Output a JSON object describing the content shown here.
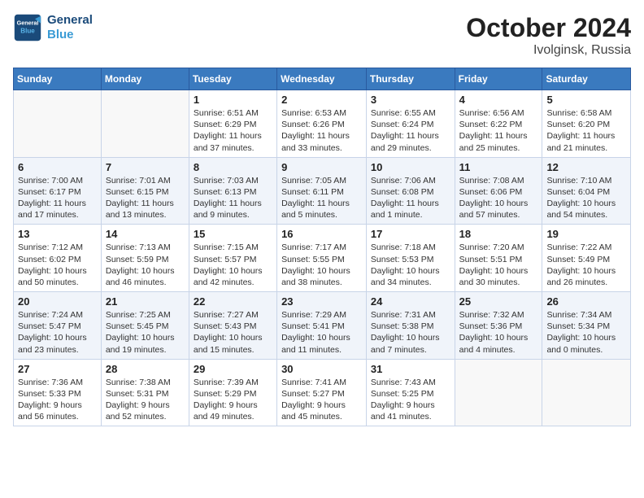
{
  "header": {
    "logo_line1": "General",
    "logo_line2": "Blue",
    "month": "October 2024",
    "location": "Ivolginsk, Russia"
  },
  "weekdays": [
    "Sunday",
    "Monday",
    "Tuesday",
    "Wednesday",
    "Thursday",
    "Friday",
    "Saturday"
  ],
  "weeks": [
    [
      {
        "day": "",
        "info": ""
      },
      {
        "day": "",
        "info": ""
      },
      {
        "day": "1",
        "info": "Sunrise: 6:51 AM\nSunset: 6:29 PM\nDaylight: 11 hours and 37 minutes."
      },
      {
        "day": "2",
        "info": "Sunrise: 6:53 AM\nSunset: 6:26 PM\nDaylight: 11 hours and 33 minutes."
      },
      {
        "day": "3",
        "info": "Sunrise: 6:55 AM\nSunset: 6:24 PM\nDaylight: 11 hours and 29 minutes."
      },
      {
        "day": "4",
        "info": "Sunrise: 6:56 AM\nSunset: 6:22 PM\nDaylight: 11 hours and 25 minutes."
      },
      {
        "day": "5",
        "info": "Sunrise: 6:58 AM\nSunset: 6:20 PM\nDaylight: 11 hours and 21 minutes."
      }
    ],
    [
      {
        "day": "6",
        "info": "Sunrise: 7:00 AM\nSunset: 6:17 PM\nDaylight: 11 hours and 17 minutes."
      },
      {
        "day": "7",
        "info": "Sunrise: 7:01 AM\nSunset: 6:15 PM\nDaylight: 11 hours and 13 minutes."
      },
      {
        "day": "8",
        "info": "Sunrise: 7:03 AM\nSunset: 6:13 PM\nDaylight: 11 hours and 9 minutes."
      },
      {
        "day": "9",
        "info": "Sunrise: 7:05 AM\nSunset: 6:11 PM\nDaylight: 11 hours and 5 minutes."
      },
      {
        "day": "10",
        "info": "Sunrise: 7:06 AM\nSunset: 6:08 PM\nDaylight: 11 hours and 1 minute."
      },
      {
        "day": "11",
        "info": "Sunrise: 7:08 AM\nSunset: 6:06 PM\nDaylight: 10 hours and 57 minutes."
      },
      {
        "day": "12",
        "info": "Sunrise: 7:10 AM\nSunset: 6:04 PM\nDaylight: 10 hours and 54 minutes."
      }
    ],
    [
      {
        "day": "13",
        "info": "Sunrise: 7:12 AM\nSunset: 6:02 PM\nDaylight: 10 hours and 50 minutes."
      },
      {
        "day": "14",
        "info": "Sunrise: 7:13 AM\nSunset: 5:59 PM\nDaylight: 10 hours and 46 minutes."
      },
      {
        "day": "15",
        "info": "Sunrise: 7:15 AM\nSunset: 5:57 PM\nDaylight: 10 hours and 42 minutes."
      },
      {
        "day": "16",
        "info": "Sunrise: 7:17 AM\nSunset: 5:55 PM\nDaylight: 10 hours and 38 minutes."
      },
      {
        "day": "17",
        "info": "Sunrise: 7:18 AM\nSunset: 5:53 PM\nDaylight: 10 hours and 34 minutes."
      },
      {
        "day": "18",
        "info": "Sunrise: 7:20 AM\nSunset: 5:51 PM\nDaylight: 10 hours and 30 minutes."
      },
      {
        "day": "19",
        "info": "Sunrise: 7:22 AM\nSunset: 5:49 PM\nDaylight: 10 hours and 26 minutes."
      }
    ],
    [
      {
        "day": "20",
        "info": "Sunrise: 7:24 AM\nSunset: 5:47 PM\nDaylight: 10 hours and 23 minutes."
      },
      {
        "day": "21",
        "info": "Sunrise: 7:25 AM\nSunset: 5:45 PM\nDaylight: 10 hours and 19 minutes."
      },
      {
        "day": "22",
        "info": "Sunrise: 7:27 AM\nSunset: 5:43 PM\nDaylight: 10 hours and 15 minutes."
      },
      {
        "day": "23",
        "info": "Sunrise: 7:29 AM\nSunset: 5:41 PM\nDaylight: 10 hours and 11 minutes."
      },
      {
        "day": "24",
        "info": "Sunrise: 7:31 AM\nSunset: 5:38 PM\nDaylight: 10 hours and 7 minutes."
      },
      {
        "day": "25",
        "info": "Sunrise: 7:32 AM\nSunset: 5:36 PM\nDaylight: 10 hours and 4 minutes."
      },
      {
        "day": "26",
        "info": "Sunrise: 7:34 AM\nSunset: 5:34 PM\nDaylight: 10 hours and 0 minutes."
      }
    ],
    [
      {
        "day": "27",
        "info": "Sunrise: 7:36 AM\nSunset: 5:33 PM\nDaylight: 9 hours and 56 minutes."
      },
      {
        "day": "28",
        "info": "Sunrise: 7:38 AM\nSunset: 5:31 PM\nDaylight: 9 hours and 52 minutes."
      },
      {
        "day": "29",
        "info": "Sunrise: 7:39 AM\nSunset: 5:29 PM\nDaylight: 9 hours and 49 minutes."
      },
      {
        "day": "30",
        "info": "Sunrise: 7:41 AM\nSunset: 5:27 PM\nDaylight: 9 hours and 45 minutes."
      },
      {
        "day": "31",
        "info": "Sunrise: 7:43 AM\nSunset: 5:25 PM\nDaylight: 9 hours and 41 minutes."
      },
      {
        "day": "",
        "info": ""
      },
      {
        "day": "",
        "info": ""
      }
    ]
  ]
}
